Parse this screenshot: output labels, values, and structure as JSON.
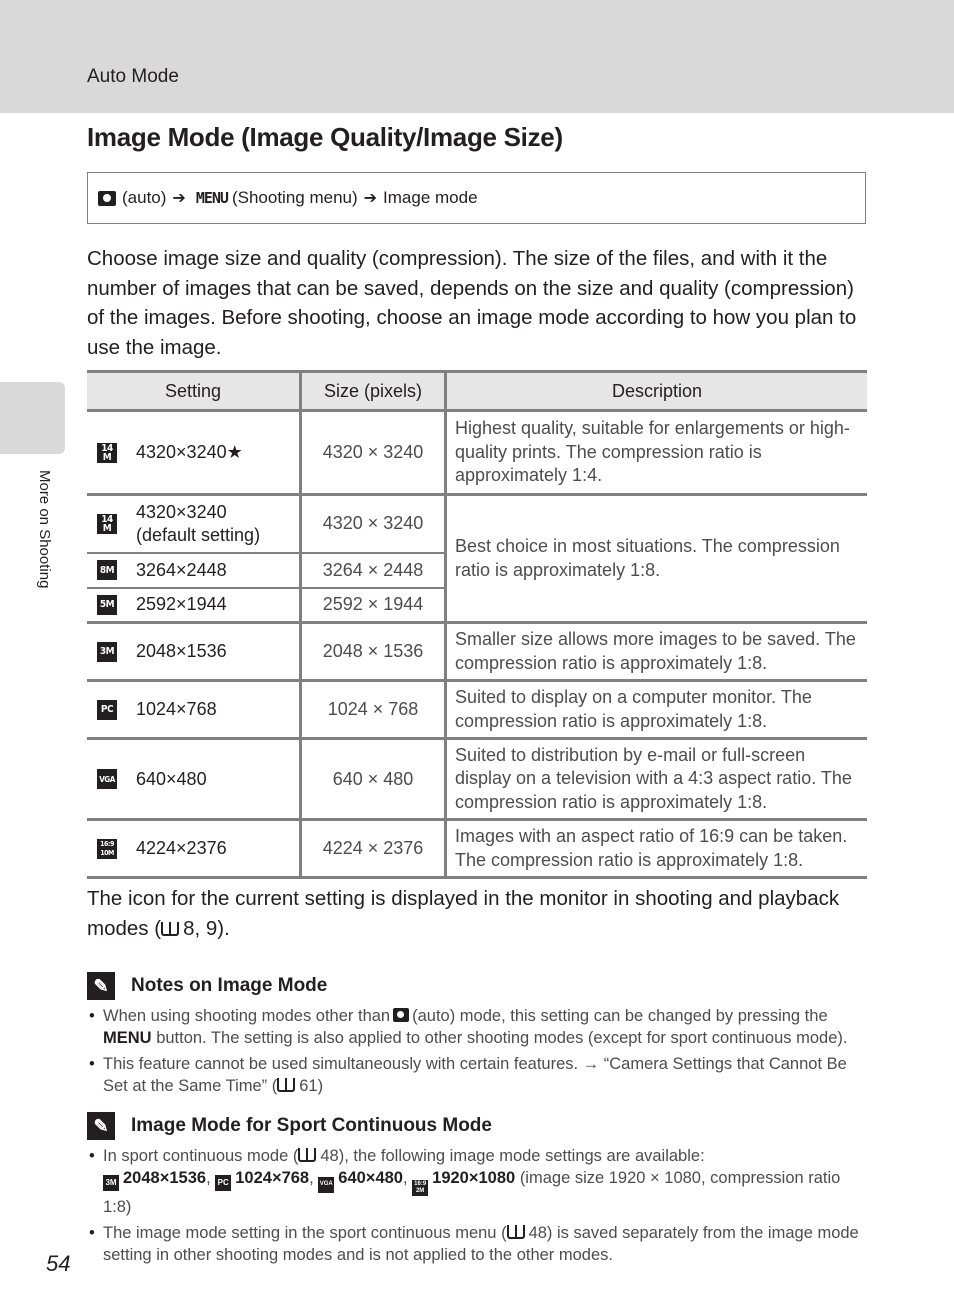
{
  "header": {
    "section": "Auto Mode"
  },
  "title": "Image Mode (Image Quality/Image Size)",
  "nav_path": {
    "camera_icon": "camera-icon",
    "auto": "(auto)",
    "arrow": "➔",
    "menu_glyph": "MENU",
    "shooting_menu": "(Shooting menu)",
    "image_mode": "Image mode"
  },
  "intro": "Choose image size and quality (compression). The size of the files, and with it the number of images that can be saved, depends on the size and quality (compression) of the images. Before shooting, choose an image mode according to how you plan to use the image.",
  "table": {
    "headers": [
      "Setting",
      "Size (pixels)",
      "Description"
    ],
    "rows": [
      {
        "icon": "14M★",
        "setting": "4320×3240★",
        "size": "4320 × 3240",
        "description": "Highest quality, suitable for enlargements or high-quality prints. The compression ratio is approximately 1:4."
      },
      {
        "icon": "14M",
        "setting": "4320×3240",
        "setting_sub": "(default setting)",
        "size": "4320 × 3240",
        "description": "Best choice in most situations. The compression ratio is approximately 1:8."
      },
      {
        "icon": "8M",
        "setting": "3264×2448",
        "size": "3264 × 2448"
      },
      {
        "icon": "5M",
        "setting": "2592×1944",
        "size": "2592 × 1944"
      },
      {
        "icon": "3M",
        "setting": "2048×1536",
        "size": "2048 × 1536",
        "description": "Smaller size allows more images to be saved. The compression ratio is approximately 1:8."
      },
      {
        "icon": "PC",
        "setting": "1024×768",
        "size": "1024 × 768",
        "description": "Suited to display on a computer monitor. The compression ratio is approximately 1:8."
      },
      {
        "icon": "VGA",
        "setting": "640×480",
        "size": "640 × 480",
        "description": "Suited to distribution by e-mail or full-screen display on a television with a 4:3 aspect ratio. The compression ratio is approximately 1:8."
      },
      {
        "icon": "16:9 10M",
        "setting": "4224×2376",
        "size": "4224 × 2376",
        "description": "Images with an aspect ratio of 16:9 can be taken. The compression ratio is approximately 1:8."
      }
    ]
  },
  "after_table": {
    "text": "The icon for the current setting is displayed in the monitor in shooting and playback modes (",
    "ref": "8, 9)."
  },
  "notes": [
    {
      "title": "Notes on Image Mode",
      "items": [
        {
          "a": "When using shooting modes other than",
          "b": "(auto) mode, this setting can be changed by pressing the",
          "menu": "MENU",
          "c": "button. The setting is also applied to other shooting modes (except for sport continuous mode)."
        },
        {
          "a": "This feature cannot be used simultaneously with certain features. → “Camera Settings that Cannot Be Set at the Same Time” (",
          "ref": "61)"
        }
      ]
    },
    {
      "title": "Image Mode for Sport Continuous Mode",
      "items": [
        {
          "a": "In sport continuous mode (",
          "ref": "48), the following image mode settings are available:",
          "opt1_icon": "3M",
          "opt1": "2048×1536",
          "opt2_icon": "PC",
          "opt2": "1024×768",
          "opt3_icon": "VGA",
          "opt3": "640×480",
          "opt4_icon": "16:9 2M",
          "opt4": "1920×1080",
          "tail": "(image size 1920 × 1080, compression ratio 1:8)"
        },
        {
          "a": "The image mode setting in the sport continuous menu (",
          "ref": "48) is saved separately from the image mode setting in other shooting modes and is not applied to the other modes."
        }
      ]
    }
  ],
  "side_tab": "More on Shooting",
  "page_number": "54"
}
